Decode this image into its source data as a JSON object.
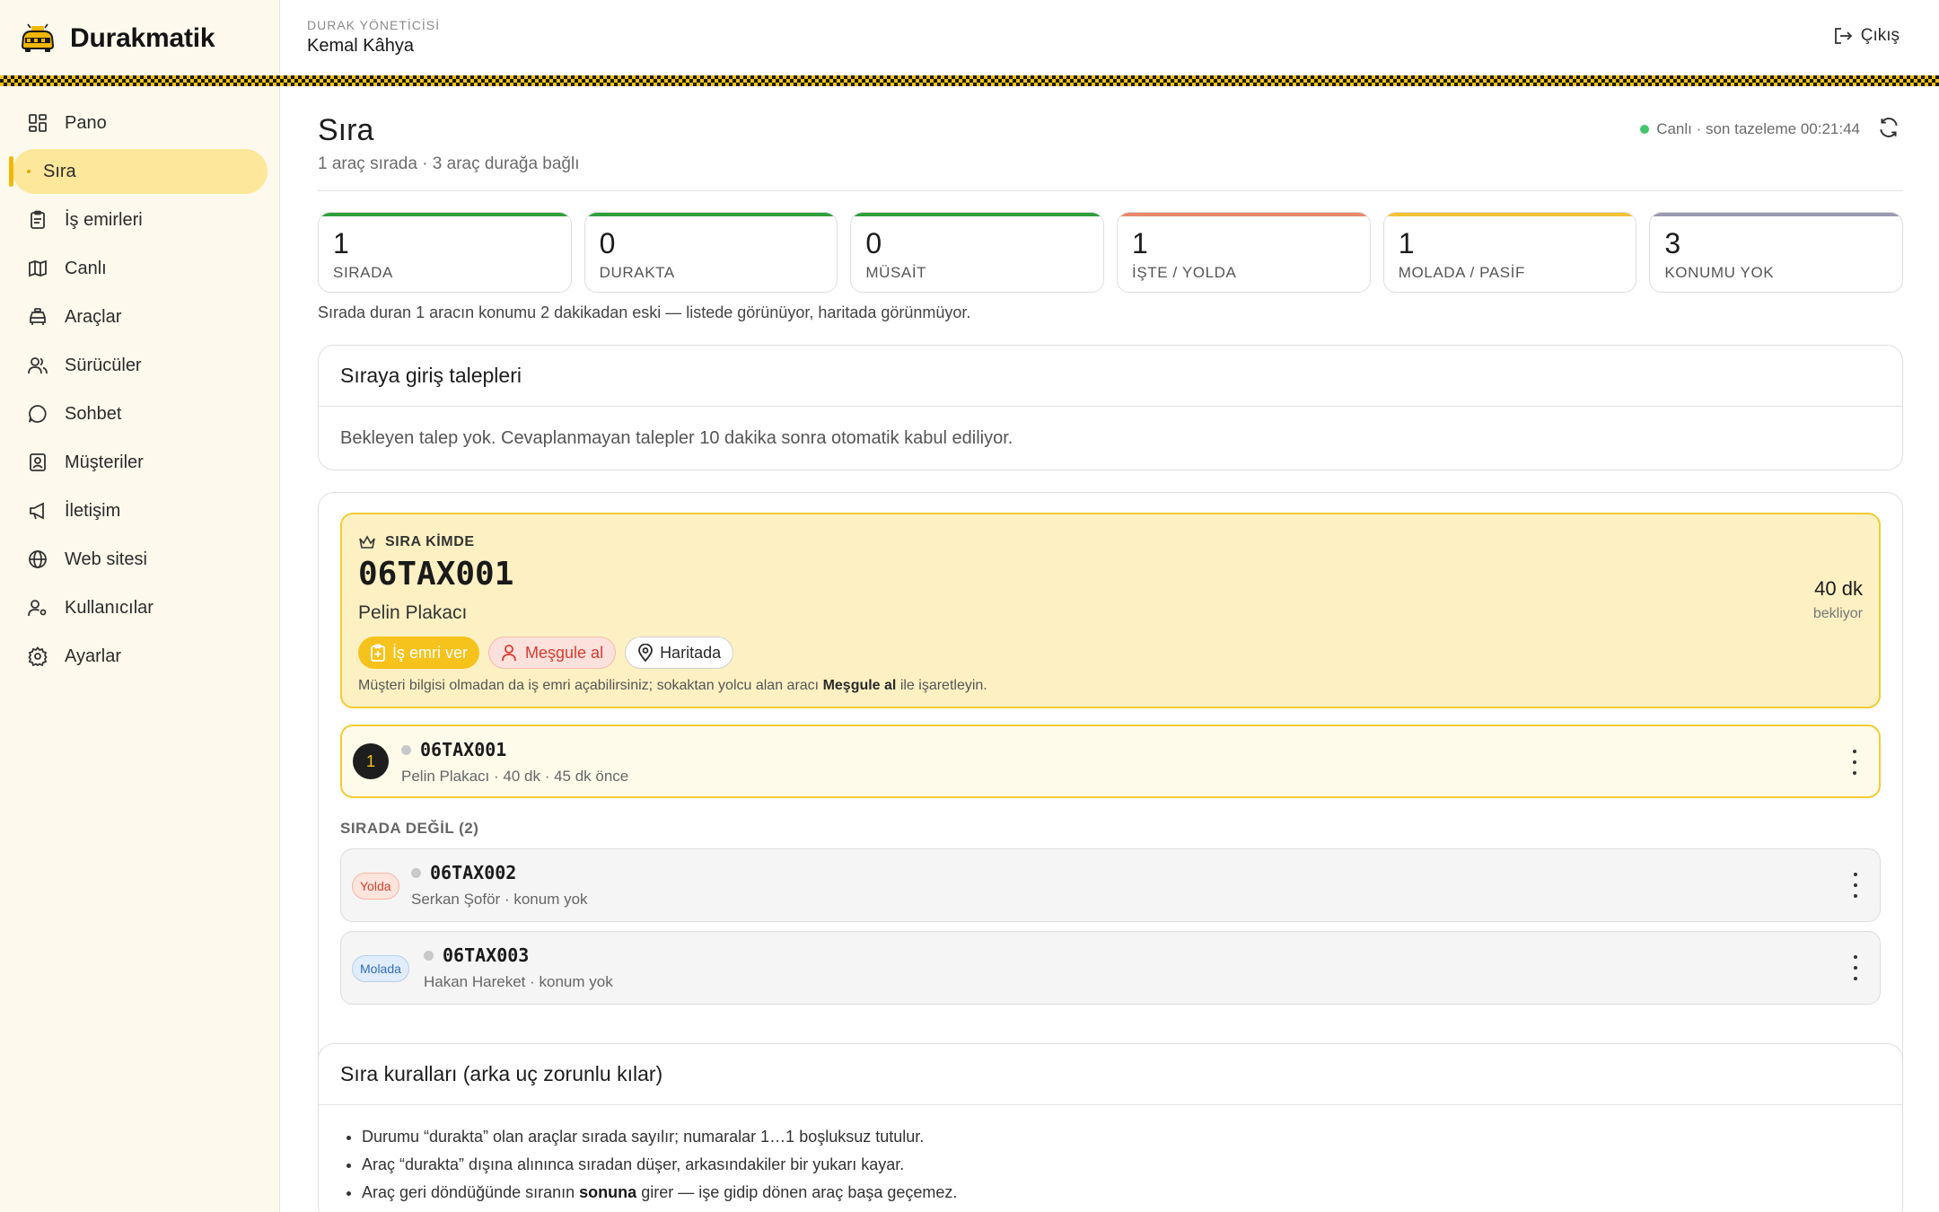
{
  "app": {
    "name": "Durakmatik"
  },
  "header": {
    "role_label": "DURAK YÖNETİCİSİ",
    "manager_name": "Kemal Kâhya",
    "logout_label": "Çıkış"
  },
  "sidebar": {
    "items": [
      {
        "label": "Pano",
        "icon": "dashboard-icon"
      },
      {
        "label": "Sıra",
        "icon": "queue-icon",
        "active": true
      },
      {
        "label": "İş emirleri",
        "icon": "clipboard-icon"
      },
      {
        "label": "Canlı",
        "icon": "map-icon"
      },
      {
        "label": "Araçlar",
        "icon": "car-icon"
      },
      {
        "label": "Sürücüler",
        "icon": "users-icon"
      },
      {
        "label": "Sohbet",
        "icon": "chat-icon"
      },
      {
        "label": "Müşteriler",
        "icon": "contact-icon"
      },
      {
        "label": "İletişim",
        "icon": "megaphone-icon"
      },
      {
        "label": "Web sitesi",
        "icon": "globe-icon"
      },
      {
        "label": "Kullanıcılar",
        "icon": "user-key-icon"
      },
      {
        "label": "Ayarlar",
        "icon": "gear-icon"
      }
    ]
  },
  "page": {
    "title": "Sıra",
    "subtitle": "1 araç sırada · 3 araç durağa bağlı",
    "live_status": "Canlı · son tazeleme 00:21:44"
  },
  "stats": [
    {
      "value": "1",
      "label": "SIRADA",
      "color": "#2e9e3a"
    },
    {
      "value": "0",
      "label": "DURAKTA",
      "color": "#2e9e3a"
    },
    {
      "value": "0",
      "label": "MÜSAİT",
      "color": "#2e9e3a"
    },
    {
      "value": "1",
      "label": "İŞTE / YOLDA",
      "color": "#e9876b"
    },
    {
      "value": "1",
      "label": "MOLADA / PASİF",
      "color": "#f3c234"
    },
    {
      "value": "3",
      "label": "KONUMU YOK",
      "color": "#9a9ab0"
    }
  ],
  "stat_note": "Sırada duran 1 aracın konumu 2 dakikadan eski — listede görünüyor, haritada görünmüyor.",
  "requests": {
    "title": "Sıraya giriş talepleri",
    "empty_text": "Bekleyen talep yok. Cevaplanmayan talepler 10 dakika sonra otomatik kabul ediliyor."
  },
  "queue": {
    "hero": {
      "label": "SIRA KİMDE",
      "plate": "06TAX001",
      "driver": "Pelin Plakacı",
      "wait_value": "40 dk",
      "wait_unit": "bekliyor",
      "btn_order": "İş emri ver",
      "btn_busy": "Meşgule al",
      "btn_map": "Haritada",
      "hint_before": "Müşteri bilgisi olmadan da iş emri açabilirsiniz; sokaktan yolcu alan aracı ",
      "hint_bold": "Meşgule al",
      "hint_after": " ile işaretleyin."
    },
    "in_queue": [
      {
        "position": "1",
        "plate": "06TAX001",
        "meta": "Pelin Plakacı · 40 dk · 45 dk önce"
      }
    ],
    "not_in_queue_label": "SIRADA DEĞİL (2)",
    "not_in_queue": [
      {
        "status": "Yolda",
        "plate": "06TAX002",
        "meta": "Serkan Şoför · konum yok"
      },
      {
        "status": "Molada",
        "plate": "06TAX003",
        "meta": "Hakan Hareket · konum yok"
      }
    ]
  },
  "rules": {
    "title": "Sıra kuralları (arka uç zorunlu kılar)",
    "items": [
      {
        "before": "Durumu “durakta” olan araçlar sırada sayılır; numaralar 1…1 boşluksuz tutulur.",
        "bold": "",
        "after": ""
      },
      {
        "before": "Araç “durakta” dışına alınınca sıradan düşer, arkasındakiler bir yukarı kayar.",
        "bold": "",
        "after": ""
      },
      {
        "before": "Araç geri döndüğünde sıranın ",
        "bold": "sonuna",
        "after": " girer — işe gidip dönen araç başa geçemez."
      }
    ]
  }
}
